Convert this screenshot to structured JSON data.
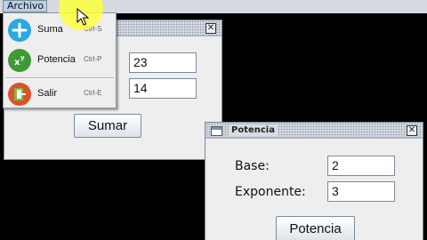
{
  "menubar": {
    "archivo_label": "Archivo"
  },
  "menu": {
    "items": [
      {
        "label": "Suma",
        "accelerator": "Ctrl-S",
        "icon": "plus-icon",
        "color": "#2aa8e0"
      },
      {
        "label": "Potencia",
        "accelerator": "Ctrl-P",
        "icon": "xy-icon",
        "color": "#3f9a35"
      },
      {
        "label": "Salir",
        "accelerator": "Ctrl-E",
        "icon": "exit-icon",
        "color": "#e0502a"
      }
    ]
  },
  "suma_window": {
    "field1_value": "23",
    "field2_value": "14",
    "button_label": "Sumar"
  },
  "potencia_window": {
    "title": "Potencia",
    "base_label": "Base:",
    "base_value": "2",
    "exp_label": "Exponente:",
    "exp_value": "3",
    "button_label": "Potencia"
  }
}
